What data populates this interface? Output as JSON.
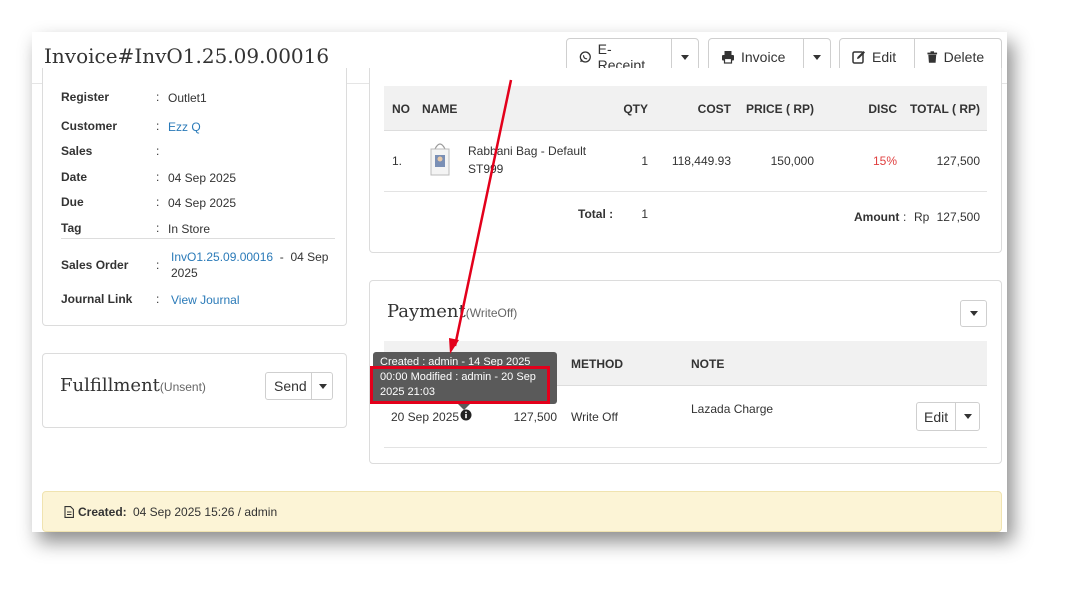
{
  "header": {
    "title": "Invoice#InvO1.25.09.00016",
    "buttons": {
      "ereceipt_label": "E-Receipt",
      "invoice_label": "Invoice",
      "edit_label": "Edit",
      "delete_label": "Delete"
    }
  },
  "info": {
    "rows": [
      {
        "key": "Register",
        "value": "Outlet1"
      },
      {
        "key": "Customer",
        "value": "Ezz Q"
      },
      {
        "key": "Sales",
        "value": ""
      },
      {
        "key": "Date",
        "value": "04 Sep 2025"
      },
      {
        "key": "Due",
        "value": "04 Sep 2025"
      },
      {
        "key": "Tag",
        "value": "In Store"
      }
    ],
    "sales_order": {
      "key": "Sales Order",
      "link": "InvO1.25.09.00016",
      "sep": "-",
      "date_part1": "04 Sep",
      "date_part2": "2025"
    },
    "journal": {
      "key": "Journal Link",
      "link": "View Journal"
    },
    "colon": ":"
  },
  "fulfillment": {
    "title": "Fulfillment",
    "status": "(Unsent)",
    "send_label": "Send"
  },
  "items": {
    "headers": {
      "no": "NO",
      "name": "NAME",
      "qty": "QTY",
      "cost": "COST",
      "price": "PRICE ( RP)",
      "disc": "DISC",
      "total": "TOTAL ( RP)"
    },
    "rows": [
      {
        "no": "1.",
        "name": "Rabbani Bag - Default",
        "sku": "ST999",
        "qty": "1",
        "cost": "118,449.93",
        "price": "150,000",
        "disc": "15%",
        "total": "127,500"
      }
    ],
    "summary": {
      "total_label": "Total :",
      "total_qty": "1",
      "amount_label": "Amount",
      "colon": ":",
      "currency": "Rp",
      "amount": "127,500"
    }
  },
  "payment": {
    "title": "Payment",
    "status": "(WriteOff)",
    "headers": {
      "method": "METHOD",
      "note": "NOTE"
    },
    "rows": [
      {
        "date": "20 Sep 2025",
        "amount": "127,500",
        "method": "Write Off",
        "note": "Lazada Charge",
        "edit_label": "Edit"
      }
    ],
    "tooltip": {
      "line1": "Created : admin - 14 Sep 2025",
      "line2": "00:00 Modified : admin - 20 Sep",
      "line3": "2025 21:03"
    }
  },
  "footer": {
    "created_label": "Created:",
    "created_value": "04 Sep 2025 15:26 / admin"
  },
  "colors": {
    "accent_link": "#2a7ab8",
    "discount_red": "#e04040",
    "highlight_red": "#e3001b",
    "footer_bg": "#fcf4d6"
  },
  "icons": [
    "whatsapp-icon",
    "printer-icon",
    "edit-icon",
    "trash-icon",
    "info-icon",
    "document-icon",
    "bag-product-thumbnail"
  ]
}
